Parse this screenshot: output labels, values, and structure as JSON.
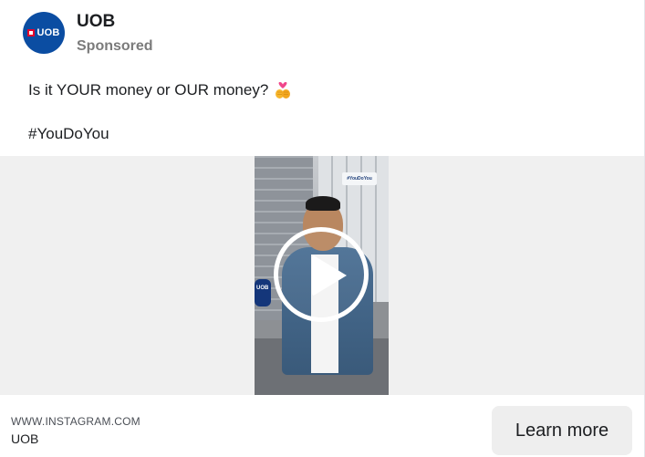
{
  "post": {
    "page_name": "UOB",
    "sponsored_label": "Sponsored",
    "avatar_text": "UOB",
    "caption": "Is it YOUR money or OUR money?",
    "hashtag": "#YouDoYou",
    "emoji_icon": "heart-hands-emoji"
  },
  "video": {
    "sign_text": "#YouDoYou",
    "mic_text": "UOB",
    "play_icon": "play-icon"
  },
  "footer": {
    "domain": "WWW.INSTAGRAM.COM",
    "advertiser": "UOB",
    "cta_label": "Learn more"
  },
  "colors": {
    "brand_blue": "#0b4da2",
    "brand_red": "#e4002b",
    "cta_bg": "#eeeeee",
    "media_bg": "#f0f0f0"
  }
}
